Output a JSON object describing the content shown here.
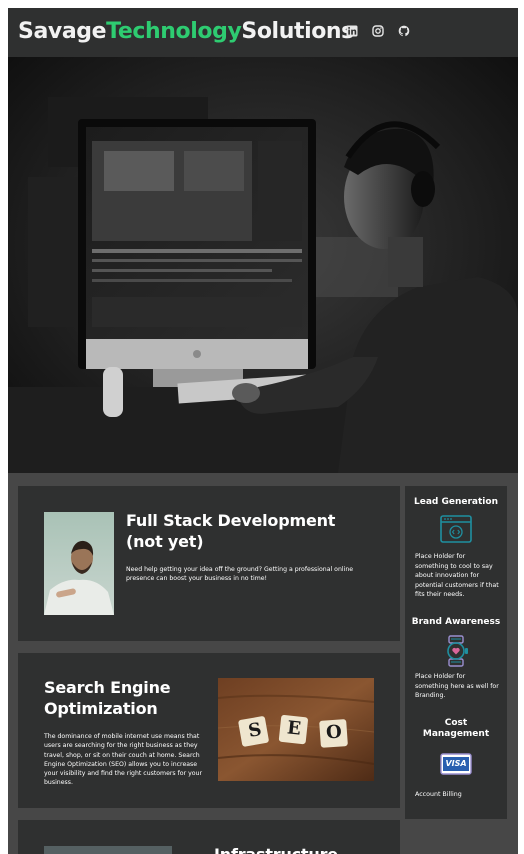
{
  "brand": {
    "part1": "Savage",
    "part2": "Technology",
    "part3": "Solutions"
  },
  "header": {
    "social_icons": [
      "linkedin-icon",
      "instagram-icon",
      "github-icon"
    ]
  },
  "cards": [
    {
      "title_line1": "Full Stack Development",
      "title_line2": "(not yet)",
      "body": "Need help getting your idea off the ground? Getting a professional online presence can boost your business in no time!"
    },
    {
      "title_line1": "Search Engine",
      "title_line2": "Optimization",
      "body": "The dominance of mobile internet use means that users are searching for the right business as they travel, shop, or sit on their couch at home. Search Engine Optimization (SEO) allows you to increase your visibility and find the right customers for your business.",
      "image_tiles": [
        "S",
        "E",
        "O"
      ]
    },
    {
      "title_line1": "Infrastructure"
    }
  ],
  "sidebar": [
    {
      "title": "Lead Generation",
      "icon": "code-window-icon",
      "text": "Place Holder for something to cool to say about innovation for potential customers if that fits their needs."
    },
    {
      "title": "Brand Awareness",
      "icon": "smartwatch-icon",
      "text": "Place Holder for something here as well for Branding."
    },
    {
      "title_line1": "Cost",
      "title_line2": "Management",
      "icon": "visa-card-icon",
      "text": "Account Billing",
      "card_label": "VISA"
    }
  ],
  "colors": {
    "accent": "#2ecc71",
    "panel": "#2f3030",
    "page": "#474747",
    "icon_teal": "#1f8fa0"
  }
}
